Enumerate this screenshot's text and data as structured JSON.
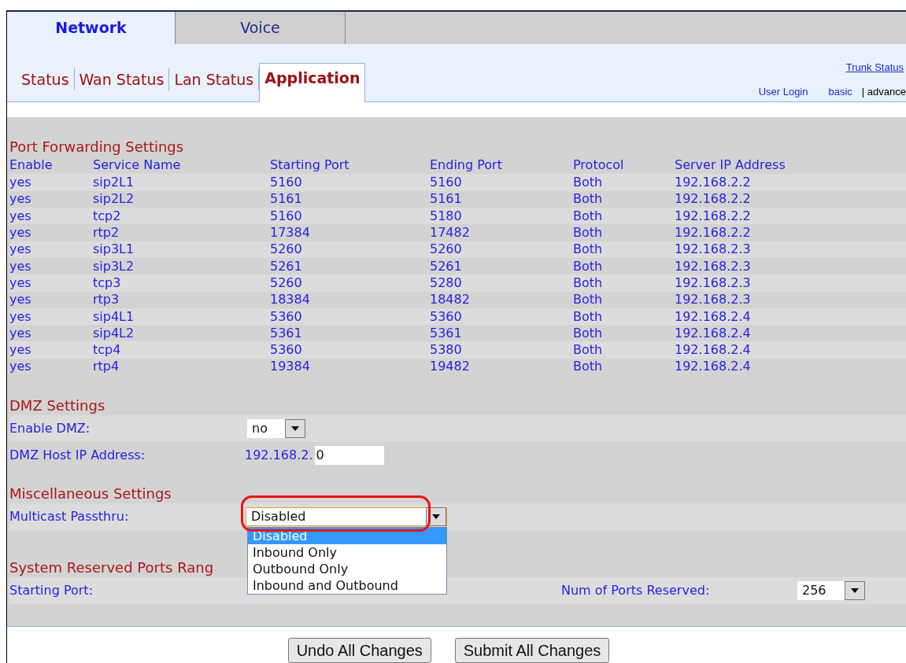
{
  "top_tabs": [
    {
      "label": "Network",
      "selected": true
    },
    {
      "label": "Voice",
      "selected": false
    }
  ],
  "sub_tabs": [
    {
      "label": "Status",
      "selected": false
    },
    {
      "label": "Wan Status",
      "selected": false
    },
    {
      "label": "Lan Status",
      "selected": false
    },
    {
      "label": "Application",
      "selected": true
    }
  ],
  "header_links": {
    "trunk_status": "Trunk Status",
    "user_login": "User Login",
    "basic": "basic",
    "advanced": "| advance"
  },
  "port_forwarding": {
    "title": "Port Forwarding Settings",
    "columns": [
      "Enable",
      "Service Name",
      "Starting Port",
      "Ending Port",
      "Protocol",
      "Server IP Address"
    ],
    "rows": [
      [
        "yes",
        "sip2L1",
        "5160",
        "5160",
        "Both",
        "192.168.2.2"
      ],
      [
        "yes",
        "sip2L2",
        "5161",
        "5161",
        "Both",
        "192.168.2.2"
      ],
      [
        "yes",
        "tcp2",
        "5160",
        "5180",
        "Both",
        "192.168.2.2"
      ],
      [
        "yes",
        "rtp2",
        "17384",
        "17482",
        "Both",
        "192.168.2.2"
      ],
      [
        "yes",
        "sip3L1",
        "5260",
        "5260",
        "Both",
        "192.168.2.3"
      ],
      [
        "yes",
        "sip3L2",
        "5261",
        "5261",
        "Both",
        "192.168.2.3"
      ],
      [
        "yes",
        "tcp3",
        "5260",
        "5280",
        "Both",
        "192.168.2.3"
      ],
      [
        "yes",
        "rtp3",
        "18384",
        "18482",
        "Both",
        "192.168.2.3"
      ],
      [
        "yes",
        "sip4L1",
        "5360",
        "5360",
        "Both",
        "192.168.2.4"
      ],
      [
        "yes",
        "sip4L2",
        "5361",
        "5361",
        "Both",
        "192.168.2.4"
      ],
      [
        "yes",
        "tcp4",
        "5360",
        "5380",
        "Both",
        "192.168.2.4"
      ],
      [
        "yes",
        "rtp4",
        "19384",
        "19482",
        "Both",
        "192.168.2.4"
      ]
    ]
  },
  "dmz": {
    "title": "DMZ Settings",
    "enable_label": "Enable DMZ:",
    "enable_value": "no",
    "host_label": "DMZ Host IP Address:",
    "host_prefix": "192.168.2.",
    "host_value": "0"
  },
  "misc": {
    "title": "Miscellaneous Settings",
    "multicast_label": "Multicast Passthru:",
    "multicast_value": "Disabled",
    "expanded": true,
    "options": [
      {
        "label": "Disabled",
        "selected": true
      },
      {
        "label": "Inbound Only",
        "selected": false
      },
      {
        "label": "Outbound Only",
        "selected": false
      },
      {
        "label": "Inbound and Outbound",
        "selected": false
      }
    ]
  },
  "reserved": {
    "title": "System Reserved Ports Rang",
    "starting_label": "Starting Port:",
    "num_label": "Num of Ports Reserved:",
    "num_value": "256"
  },
  "buttons": [
    "Undo All Changes",
    "Submit All Changes"
  ]
}
